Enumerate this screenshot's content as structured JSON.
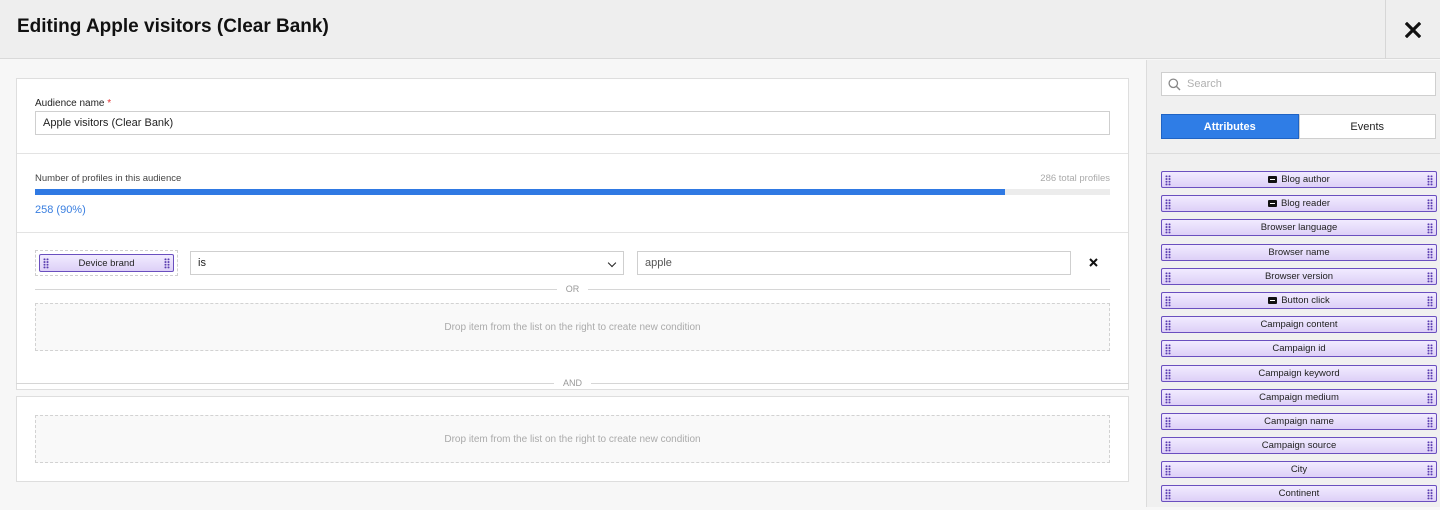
{
  "header": {
    "title": "Editing Apple visitors (Clear Bank)",
    "close_icon": "close-icon"
  },
  "audience_name": {
    "label": "Audience name",
    "required_mark": "*",
    "value": "Apple visitors (Clear Bank)"
  },
  "profiles": {
    "label": "Number of profiles in this audience",
    "total_text": "286 total profiles",
    "count_text": "258 (90%)",
    "count": 258,
    "total": 286,
    "percent": 90
  },
  "conditions": {
    "group1": {
      "attribute": "Device brand",
      "operator": "is",
      "value": "apple",
      "remove_icon": "close-icon",
      "or_label": "OR",
      "dropzone_text": "Drop item from the list on the right to create new condition"
    },
    "and_label": "AND",
    "group2": {
      "dropzone_text": "Drop item from the list on the right to create new condition"
    }
  },
  "sidebar": {
    "search_placeholder": "Search",
    "tabs": [
      {
        "label": "Attributes",
        "active": true
      },
      {
        "label": "Events",
        "active": false
      }
    ],
    "attributes": [
      {
        "label": "Blog author",
        "icon": "text-type-icon"
      },
      {
        "label": "Blog reader",
        "icon": "text-type-icon"
      },
      {
        "label": "Browser language",
        "icon": null
      },
      {
        "label": "Browser name",
        "icon": null
      },
      {
        "label": "Browser version",
        "icon": null
      },
      {
        "label": "Button click",
        "icon": "text-type-icon"
      },
      {
        "label": "Campaign content",
        "icon": null
      },
      {
        "label": "Campaign id",
        "icon": null
      },
      {
        "label": "Campaign keyword",
        "icon": null
      },
      {
        "label": "Campaign medium",
        "icon": null
      },
      {
        "label": "Campaign name",
        "icon": null
      },
      {
        "label": "Campaign source",
        "icon": null
      },
      {
        "label": "City",
        "icon": null
      },
      {
        "label": "Continent",
        "icon": null
      }
    ]
  },
  "colors": {
    "accent": "#2f7de6",
    "chip_border": "#6a4fbf",
    "chip_bg": "#e6dcfb",
    "required": "#e03030",
    "count_text": "#3a7fe0"
  }
}
